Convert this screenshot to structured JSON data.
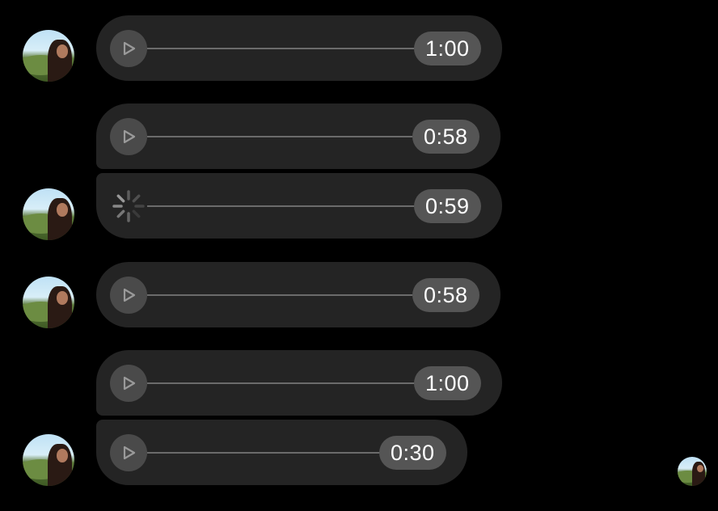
{
  "icons": {
    "play": "play-icon",
    "loading": "loading-spinner-icon",
    "avatar": "avatar"
  },
  "colors": {
    "background": "#000000",
    "bubble": "#242424",
    "play_button": "#4a4a4a",
    "play_triangle": "#9a9a9a",
    "track": "#6b6b6b",
    "duration_pill": "#555555",
    "duration_text": "#ffffff"
  },
  "messages": [
    {
      "duration": "1:00",
      "state": "ready"
    },
    {
      "duration": "0:58",
      "state": "ready"
    },
    {
      "duration": "0:59",
      "state": "loading"
    },
    {
      "duration": "0:58",
      "state": "ready"
    },
    {
      "duration": "1:00",
      "state": "ready"
    },
    {
      "duration": "0:30",
      "state": "ready"
    }
  ]
}
